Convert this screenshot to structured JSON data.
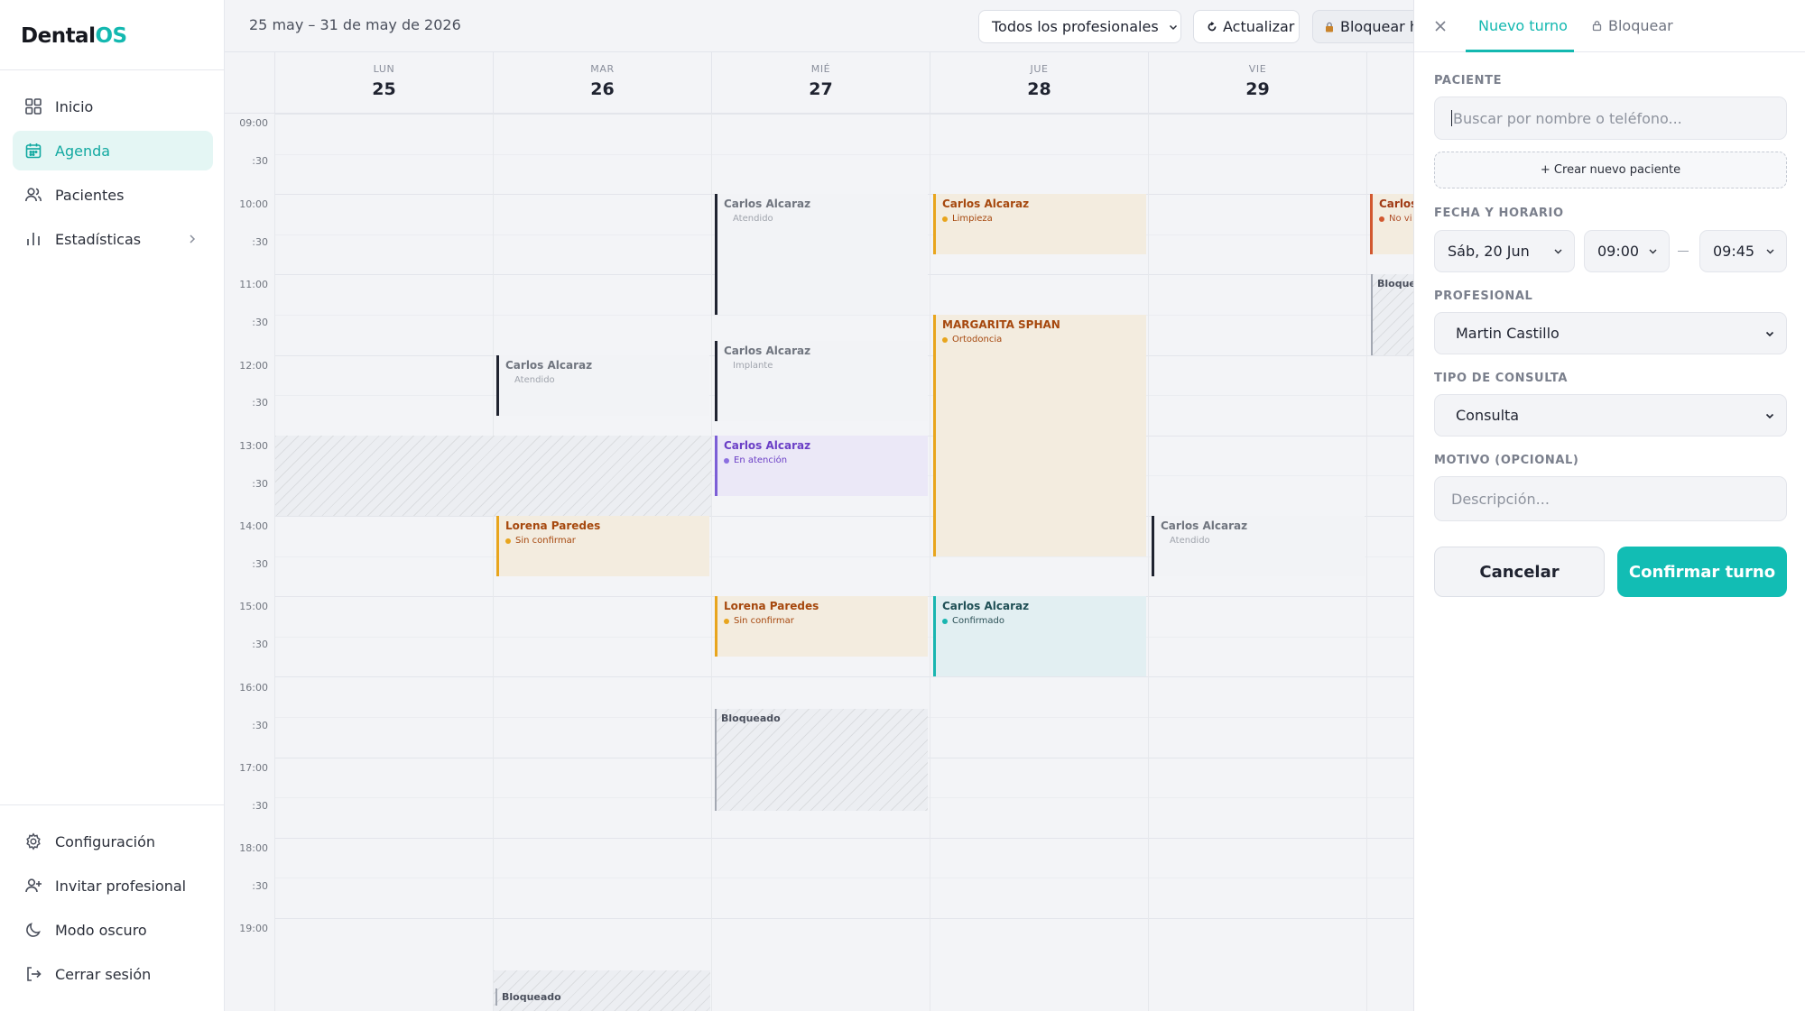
{
  "app": {
    "logo_main": "Dental",
    "logo_accent": "OS"
  },
  "sidebar": {
    "nav": [
      {
        "label": "Inicio",
        "icon": "grid-icon"
      },
      {
        "label": "Agenda",
        "icon": "calendar-icon",
        "active": true
      },
      {
        "label": "Pacientes",
        "icon": "users-icon"
      },
      {
        "label": "Estadísticas",
        "icon": "bar-chart-icon",
        "has_submenu": true
      }
    ],
    "bottom": [
      {
        "label": "Configuración",
        "icon": "gear-icon"
      },
      {
        "label": "Invitar profesional",
        "icon": "user-plus-icon"
      },
      {
        "label": "Modo oscuro",
        "icon": "moon-icon"
      },
      {
        "label": "Cerrar sesión",
        "icon": "logout-icon"
      }
    ]
  },
  "toolbar": {
    "date_range": "25 may – 31 de may de 2026",
    "professional_filter": "Todos los profesionales",
    "refresh_label": "Actualizar",
    "block_label": "Bloquear h"
  },
  "calendar": {
    "days": [
      {
        "name": "LUN",
        "num": "25"
      },
      {
        "name": "MAR",
        "num": "26"
      },
      {
        "name": "MIÉ",
        "num": "27"
      },
      {
        "name": "JUE",
        "num": "28"
      },
      {
        "name": "VIE",
        "num": "29"
      }
    ],
    "time_labels": [
      "09:00",
      ":30",
      "10:00",
      ":30",
      "11:00",
      ":30",
      "12:00",
      ":30",
      "13:00",
      ":30",
      "14:00",
      ":30",
      "15:00",
      ":30",
      "16:00",
      ":30",
      "17:00",
      ":30",
      "18:00",
      ":30",
      "19:00"
    ],
    "blocked_label": "Bloqueado",
    "events": {
      "wed_1000": {
        "name": "Carlos Alcaraz",
        "status": "Atendido"
      },
      "thu_1000": {
        "name": "Carlos Alcaraz",
        "status": "Limpieza"
      },
      "sat_1000": {
        "name": "Carlos",
        "status": "No vi"
      },
      "sat_1100": {
        "name": "Bloque"
      },
      "thu_1130": {
        "name": "MARGARITA SPHAN",
        "status": "Ortodoncia"
      },
      "wed_1130": {
        "name": "Carlos Alcaraz",
        "status": "Implante"
      },
      "tue_1200": {
        "name": "Carlos Alcaraz",
        "status": "Atendido"
      },
      "wed_1300": {
        "name": "Carlos Alcaraz",
        "status": "En atención"
      },
      "tue_1400": {
        "name": "Lorena Paredes",
        "status": "Sin confirmar"
      },
      "fri_1400": {
        "name": "Carlos Alcaraz",
        "status": "Atendido"
      },
      "wed_1500": {
        "name": "Lorena Paredes",
        "status": "Sin confirmar"
      },
      "thu_1500": {
        "name": "Carlos Alcaraz",
        "status": "Confirmado"
      }
    }
  },
  "panel": {
    "tab_new": "Nuevo turno",
    "tab_block": "Bloquear",
    "patient_label": "PACIENTE",
    "patient_placeholder": "Buscar por nombre o teléfono...",
    "create_patient": "+ Crear nuevo paciente",
    "datetime_label": "FECHA Y HORARIO",
    "date_value": "Sáb, 20 Jun",
    "start_time": "09:00",
    "end_time": "09:45",
    "professional_label": "PROFESIONAL",
    "professional_value": "Martin Castillo",
    "type_label": "TIPO DE CONSULTA",
    "type_value": "Consulta",
    "reason_label": "MOTIVO (OPCIONAL)",
    "reason_placeholder": "Descripción...",
    "cancel": "Cancelar",
    "confirm": "Confirmar turno"
  },
  "colors": {
    "accent": "#13b8b0",
    "pending": "#e8a51d",
    "attending": "#7c5fd6",
    "confirmed": "#19b5b0",
    "no_show": "#d2582f"
  }
}
